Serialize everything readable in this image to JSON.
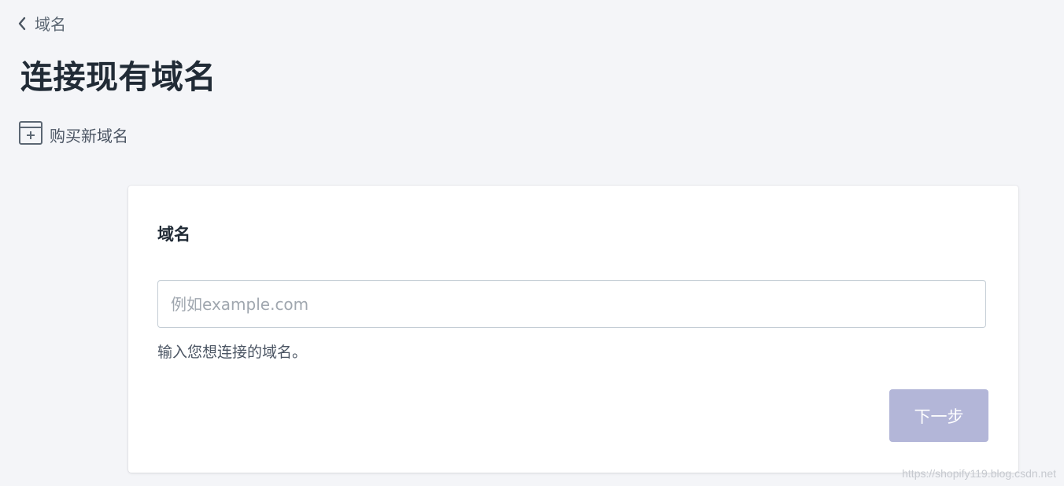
{
  "breadcrumb": {
    "label": "域名",
    "icon": "chevron-left-icon"
  },
  "page": {
    "title": "连接现有域名"
  },
  "buy_link": {
    "label": "购买新域名",
    "icon": "add-browser-icon"
  },
  "card": {
    "title": "域名",
    "input": {
      "value": "",
      "placeholder": "例如example.com"
    },
    "help_text": "输入您想连接的域名。",
    "next_button_label": "下一步"
  },
  "watermark": "https://shopify119.blog.csdn.net",
  "colors": {
    "background": "#f4f5f8",
    "card": "#ffffff",
    "button_disabled": "#b3b6d8",
    "text_primary": "#212b36",
    "text_secondary": "#5c6773"
  }
}
